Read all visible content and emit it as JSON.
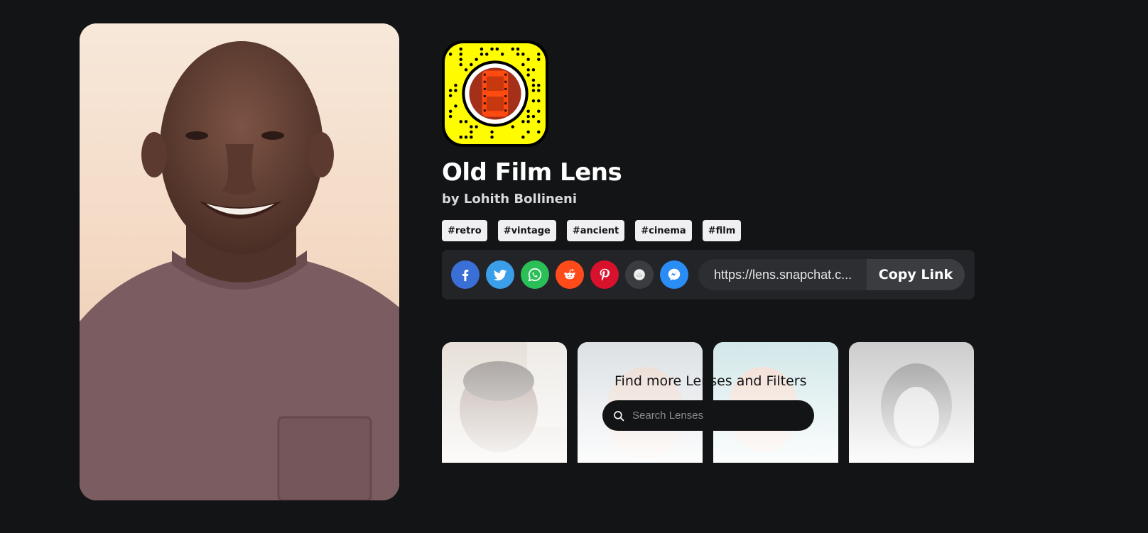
{
  "lens": {
    "title": "Old Film Lens",
    "author": "by Lohith Bollineni",
    "tags": [
      "#retro",
      "#vintage",
      "#ancient",
      "#cinema",
      "#film"
    ]
  },
  "share": {
    "icons": [
      {
        "name": "facebook-icon",
        "color": "#3b6fd8"
      },
      {
        "name": "twitter-icon",
        "color": "#3b9ee8"
      },
      {
        "name": "whatsapp-icon",
        "color": "#2bbf57"
      },
      {
        "name": "reddit-icon",
        "color": "#ff4b1a"
      },
      {
        "name": "pinterest-icon",
        "color": "#d8112c"
      },
      {
        "name": "email-icon",
        "color": "#3a3c40"
      },
      {
        "name": "messenger-icon",
        "color": "#2a8cf5"
      }
    ],
    "link_text": "https://lens.snapchat.c...",
    "copy_label": "Copy Link"
  },
  "more": {
    "title": "Find more Lenses and Filters",
    "search_placeholder": "Search Lenses"
  },
  "colors": {
    "background": "#131416",
    "snapcode_yellow": "#fffc00",
    "film_orange": "#ff4a10"
  }
}
